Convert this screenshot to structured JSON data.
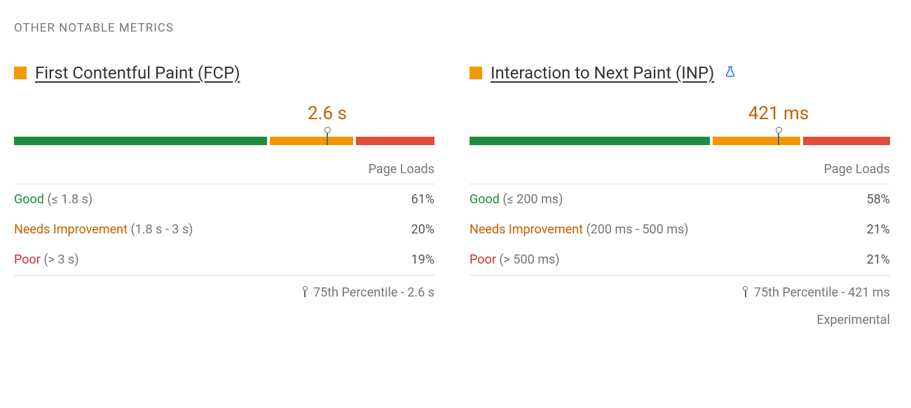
{
  "section_header": "OTHER NOTABLE METRICS",
  "shared": {
    "page_loads_label": "Page Loads",
    "good_label": "Good",
    "ni_label": "Needs Improvement",
    "poor_label": "Poor",
    "percentile_label_prefix": "75th Percentile - "
  },
  "metrics": {
    "fcp": {
      "title": "First Contentful Paint (FCP)",
      "value": "2.6 s",
      "status_color": "#f29900",
      "good_range": "(≤ 1.8 s)",
      "ni_range": "(1.8 s - 3 s)",
      "poor_range": "(> 3 s)",
      "good_pct": "61%",
      "ni_pct": "20%",
      "poor_pct": "19%",
      "percentile_value": "2.6 s",
      "marker_left_pct": "74.5%",
      "percentile_full": "75th Percentile - 2.6 s"
    },
    "inp": {
      "title": "Interaction to Next Paint (INP)",
      "value": "421 ms",
      "status_color": "#f29900",
      "good_range": "(≤ 200 ms)",
      "ni_range": "(200 ms - 500 ms)",
      "poor_range": "(> 500 ms)",
      "good_pct": "58%",
      "ni_pct": "21%",
      "poor_pct": "21%",
      "percentile_value": "421 ms",
      "marker_left_pct": "73.5%",
      "experimental_label": "Experimental",
      "percentile_full": "75th Percentile - 421 ms"
    }
  },
  "chart_data": [
    {
      "type": "bar",
      "title": "First Contentful Paint (FCP) distribution",
      "categories": [
        "Good (≤ 1.8 s)",
        "Needs Improvement (1.8 s - 3 s)",
        "Poor (> 3 s)"
      ],
      "values": [
        61,
        20,
        19
      ],
      "p75": "2.6 s",
      "ylabel": "Page Loads (%)"
    },
    {
      "type": "bar",
      "title": "Interaction to Next Paint (INP) distribution",
      "categories": [
        "Good (≤ 200 ms)",
        "Needs Improvement (200 ms - 500 ms)",
        "Poor (> 500 ms)"
      ],
      "values": [
        58,
        21,
        21
      ],
      "p75": "421 ms",
      "ylabel": "Page Loads (%)"
    }
  ]
}
